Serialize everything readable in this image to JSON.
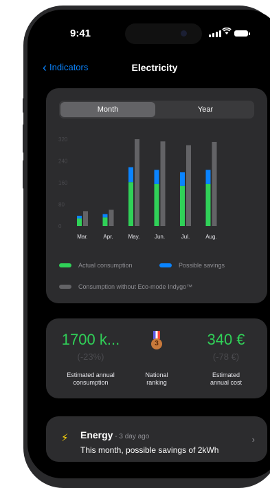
{
  "status": {
    "time": "9:41"
  },
  "nav": {
    "back_label": "Indicators",
    "title": "Electricity"
  },
  "segment": {
    "options": [
      "Month",
      "Year"
    ],
    "selected": "Month"
  },
  "chart_data": {
    "type": "bar",
    "categories": [
      "Mar.",
      "Apr.",
      "May.",
      "Jun.",
      "Jul.",
      "Aug."
    ],
    "series": [
      {
        "name": "Actual consumption",
        "stack": "a",
        "values": [
          28,
          32,
          162,
          155,
          148,
          155
        ],
        "color": "#30d158"
      },
      {
        "name": "Possible savings",
        "stack": "a",
        "values": [
          10,
          12,
          55,
          52,
          50,
          52
        ],
        "color": "#0a84ff"
      },
      {
        "name": "Consumption without Eco-mode Indygo™",
        "stack": "b",
        "values": [
          55,
          60,
          320,
          312,
          298,
          310
        ],
        "color": "#636366"
      }
    ],
    "yticks": [
      0,
      80,
      160,
      240,
      320
    ],
    "ylim": [
      0,
      320
    ],
    "legend_placement": "bottom",
    "grid": false
  },
  "legend": [
    {
      "label": "Actual consumption",
      "color": "#30d158"
    },
    {
      "label": "Possible savings",
      "color": "#0a84ff"
    },
    {
      "label": "Consumption without Eco-mode Indygo™",
      "color": "#636366"
    }
  ],
  "stats": {
    "consumption": {
      "value": "1700 k...",
      "delta": "(-23%)",
      "label_line1": "Estimated annual",
      "label_line2": "consumption"
    },
    "ranking": {
      "rank": "3",
      "label_line1": "National",
      "label_line2": "ranking"
    },
    "cost": {
      "value": "340 €",
      "delta": "(-78 €)",
      "label_line1": "Estimated",
      "label_line2": "annual cost"
    }
  },
  "energy": {
    "title": "Energy",
    "ago": " - 3 day ago",
    "message": "This month, possible savings of 2kWh"
  },
  "colors": {
    "accent": "#0a84ff",
    "green": "#30d158",
    "card": "#2c2c2e"
  }
}
